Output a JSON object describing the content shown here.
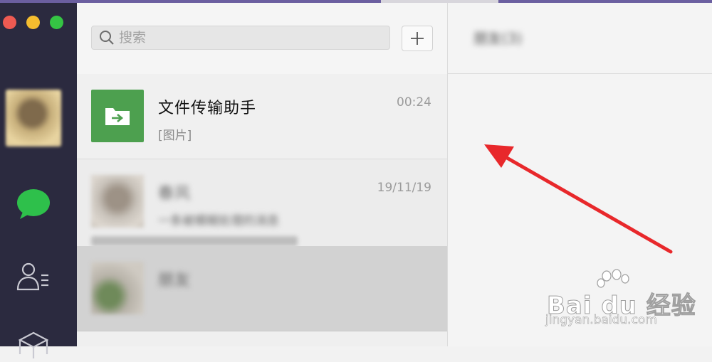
{
  "window": {
    "traffic_lights": {
      "close": "#ee5a52",
      "minimize": "#f5bd2f",
      "zoom": "#35c444"
    }
  },
  "nav": {
    "items": [
      {
        "id": "avatar",
        "icon": "avatar"
      },
      {
        "id": "chats",
        "icon": "chat-bubble-icon",
        "color": "#2ec04b"
      },
      {
        "id": "contacts",
        "icon": "contacts-icon"
      },
      {
        "id": "favorites",
        "icon": "cube-icon"
      }
    ]
  },
  "search": {
    "placeholder": "搜索",
    "add_label": "+"
  },
  "chats": [
    {
      "name": "文件传输助手",
      "preview": "[图片]",
      "time": "00:24",
      "avatar_icon": "folder-arrow-icon",
      "avatar_color": "#4da04f"
    },
    {
      "name": "春风",
      "preview": "一条被模糊处理的消息",
      "time": "19/11/19",
      "blurred": true
    },
    {
      "name": "朋友",
      "preview": "",
      "time": "",
      "blurred": true,
      "selected": true
    }
  ],
  "conversation": {
    "title": "朋友(3)"
  },
  "annotation": {
    "type": "arrow",
    "color": "#e8282b"
  },
  "watermark": {
    "brand": "Bai du 经验",
    "url": "jingyan.baidu.com"
  }
}
